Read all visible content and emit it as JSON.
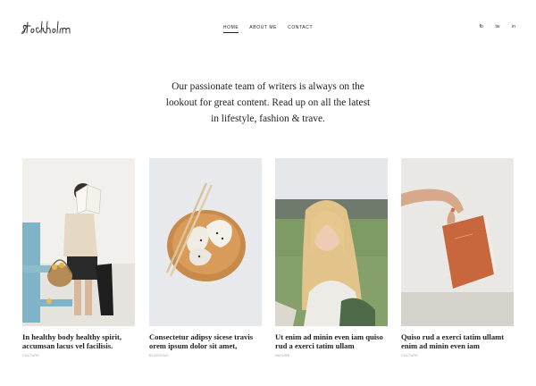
{
  "brand": {
    "logo_text": "stockholm"
  },
  "nav": {
    "items": [
      {
        "label": "HOME",
        "active": true
      },
      {
        "label": "ABOUT ME",
        "active": false
      },
      {
        "label": "CONTACT",
        "active": false
      }
    ]
  },
  "social": {
    "icons": [
      {
        "glyph": "fb",
        "name": "facebook-icon"
      },
      {
        "glyph": "tw",
        "name": "twitter-icon"
      },
      {
        "glyph": "in",
        "name": "linkedin-icon"
      }
    ]
  },
  "intro": {
    "text": "Our passionate team of writers is always on the lookout for great content. Read up on all the latest in lifestyle, fashion & trave."
  },
  "posts": [
    {
      "title": "In healthy body healthy spirit, accumsan lacus vel facilisis.",
      "category": "CULTURE",
      "image": "woman-reading-book"
    },
    {
      "title": "Consectetur adipsy sicese travis orem ipsum dolor sit amet,",
      "category": "BLOGGING",
      "image": "dumplings-on-plate"
    },
    {
      "title": "Ut enim ad minin even iam quiso rud a exerci tatim ullam",
      "category": "NATURE",
      "image": "blonde-woman-portrait"
    },
    {
      "title": "Quiso rud a exerci tatim ullamt enim ad minin even iam",
      "category": "CULTURE",
      "image": "hand-holding-notebook"
    }
  ]
}
